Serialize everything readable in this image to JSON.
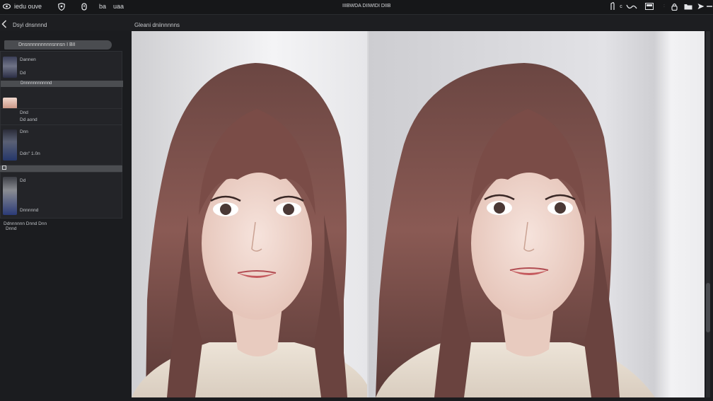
{
  "topbar": {
    "app_name": "Iedu",
    "app_name_full": "iedu ouve",
    "item2": "ba",
    "item3": "uaa",
    "center_title": "IIIBWDA DIIWIDI DIIB"
  },
  "sidebar": {
    "title": "Dsyi dnsnnnd",
    "field_label": "Dnsnnnnnnnnnsnnsn I BII",
    "entries": [
      {
        "line1": "Dannen",
        "line2": "Dd",
        "tag": "Dnnnnnnnnnnnd"
      },
      {
        "line1": "Dnd",
        "line2": "Dd aond"
      },
      {
        "line1": "Dnn",
        "line2": "Ddn\" 1.0n"
      },
      {
        "line1": "Dd",
        "line2": "Dnnnnnd"
      }
    ],
    "footer1": "Ddnnnnnn Dnnd Dnn",
    "footer2": "Dnnd"
  },
  "canvas": {
    "label": "Gleani dniinnnnns"
  },
  "colors": {
    "background": "#1b1c1f",
    "topbar": "#161719",
    "panel": "#232428",
    "canvas": "#ececee"
  }
}
